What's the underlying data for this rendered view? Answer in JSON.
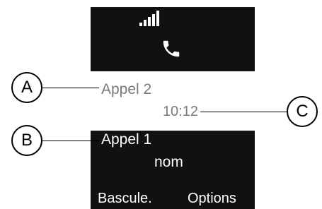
{
  "screen": {
    "active_call": {
      "name": "Appel 2",
      "time": "10:12"
    },
    "held_call": {
      "name": "Appel 1",
      "subtitle": "nom"
    },
    "softkeys": {
      "left": "Bascule.",
      "right": "Options"
    },
    "icons": [
      "signal-strength-icon",
      "phone-icon"
    ]
  },
  "callouts": {
    "a": "A",
    "b": "B",
    "c": "C"
  },
  "colors": {
    "screen_background": "#111111",
    "highlight_background": "#ffffff",
    "active_text": "#7a7a7a",
    "held_text": "#ffffff"
  }
}
